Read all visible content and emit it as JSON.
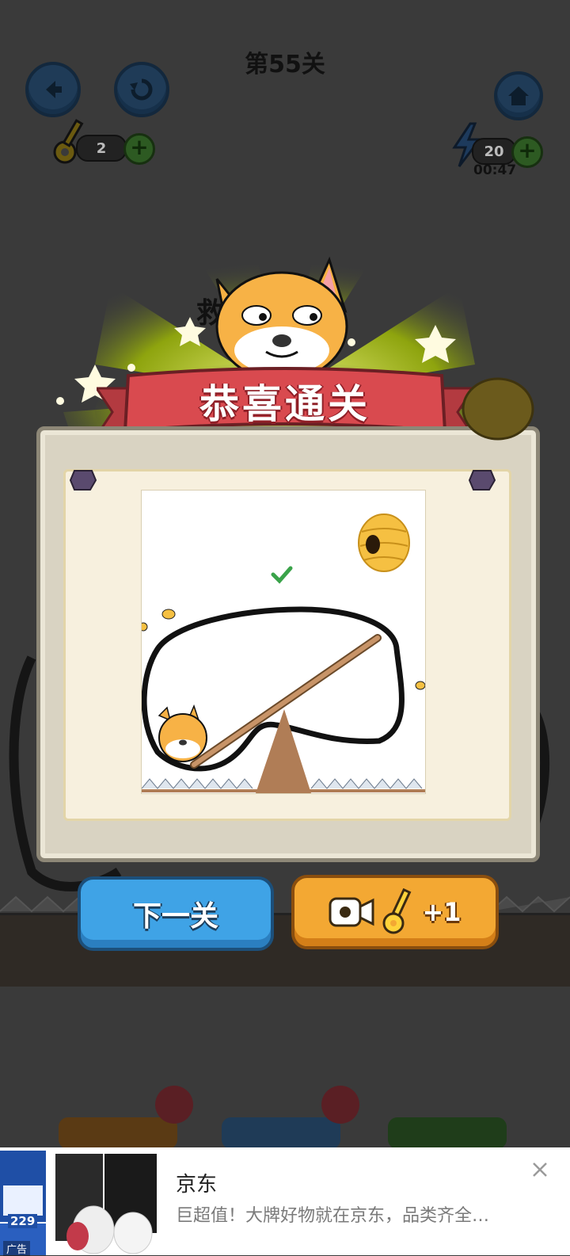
{
  "level": {
    "title": "第55关"
  },
  "hud": {
    "keys_count": "2",
    "energy_count": "20",
    "timer": "00:47"
  },
  "result": {
    "banner_text": "恭喜通关",
    "background_partial_text": "救"
  },
  "buttons": {
    "next_label": "下一关",
    "video_key_reward": "+1"
  },
  "ad": {
    "title": "京东",
    "description": "巨超值！大牌好物就在京东，品类齐全…",
    "thumb_price": "229",
    "thumb_label": "广告"
  },
  "colors": {
    "banner_red": "#d94a4f",
    "next_blue": "#3fa3e6",
    "video_orange": "#f3a833",
    "check_green": "#3aa34a"
  },
  "icons": [
    "back-arrow-icon",
    "restart-icon",
    "home-icon",
    "key-icon",
    "lightning-icon",
    "plus-icon",
    "video-icon",
    "close-icon",
    "check-icon",
    "beehive-icon",
    "bee-icon"
  ]
}
